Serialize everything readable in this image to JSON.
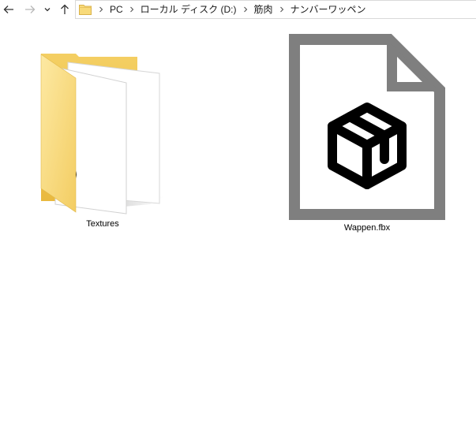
{
  "navigation": {
    "back_icon": "arrow-left-icon",
    "forward_icon": "arrow-right-icon",
    "recent_icon": "chevron-down-icon",
    "up_icon": "arrow-up-icon"
  },
  "address_bar": {
    "folder_icon": "folder-icon",
    "breadcrumbs": [
      "PC",
      "ローカル ディスク (D:)",
      "筋肉",
      "ナンバーワッペン"
    ]
  },
  "items": [
    {
      "name": "Textures",
      "type": "folder",
      "icon": "folder-with-textures-icon"
    },
    {
      "name": "Wappen.fbx",
      "type": "file",
      "icon": "3d-model-file-icon"
    }
  ],
  "colors": {
    "folder_yellow": "#f6d46a",
    "file_border": "#7f7f7f",
    "icon_black": "#000000"
  }
}
